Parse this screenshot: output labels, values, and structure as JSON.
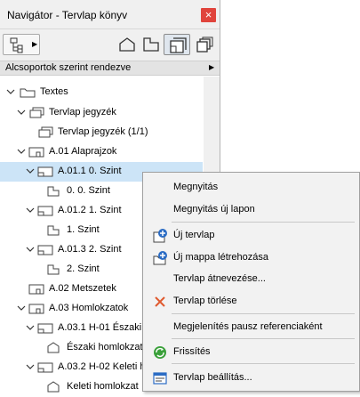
{
  "window": {
    "title": "Navigátor - Tervlap könyv",
    "close_glyph": "×"
  },
  "toolbar": {
    "tree_button_icon": "tree-options-icon",
    "views": [
      {
        "name": "project-map-icon"
      },
      {
        "name": "view-map-icon"
      },
      {
        "name": "layout-book-icon",
        "active": true
      },
      {
        "name": "publisher-sets-icon"
      }
    ]
  },
  "sort": {
    "label": "Alcsoportok szerint rendezve"
  },
  "tree": {
    "items": [
      {
        "label": "Textes"
      },
      {
        "label": "Tervlap jegyzék"
      },
      {
        "label": "Tervlap jegyzék (1/1)"
      },
      {
        "label": "A.01 Alaprajzok"
      },
      {
        "label": "A.01.1 0. Szint",
        "selected": true
      },
      {
        "label": "0. 0. Szint"
      },
      {
        "label": "A.01.2 1. Szint"
      },
      {
        "label": "1. Szint"
      },
      {
        "label": "A.01.3 2. Szint"
      },
      {
        "label": "2. Szint"
      },
      {
        "label": "A.02 Metszetek"
      },
      {
        "label": "A.03 Homlokzatok"
      },
      {
        "label": "A.03.1 H-01 Északi"
      },
      {
        "label": "Északi homlokzat"
      },
      {
        "label": "A.03.2 H-02 Keleti h"
      },
      {
        "label": "Keleti homlokzat"
      }
    ]
  },
  "context_menu": {
    "items": [
      {
        "label": "Megnyitás",
        "icon": ""
      },
      {
        "label": "Megnyitás új lapon",
        "icon": ""
      },
      {
        "label": "Új tervlap",
        "icon": "new-layout-icon"
      },
      {
        "label": "Új mappa létrehozása",
        "icon": "new-folder-icon"
      },
      {
        "label": "Tervlap átnevezése...",
        "icon": ""
      },
      {
        "label": "Tervlap törlése",
        "icon": "delete-icon"
      },
      {
        "label": "Megjelenítés pausz referenciaként",
        "icon": ""
      },
      {
        "label": "Frissítés",
        "icon": "refresh-icon"
      },
      {
        "label": "Tervlap beállítás...",
        "icon": "layout-settings-icon"
      }
    ]
  },
  "colors": {
    "selection": "#cce4f7",
    "close_button": "#e0443c",
    "delete_icon": "#e05a2e",
    "refresh_icon": "#3aa03a",
    "accent_blue": "#2b6cc4"
  }
}
